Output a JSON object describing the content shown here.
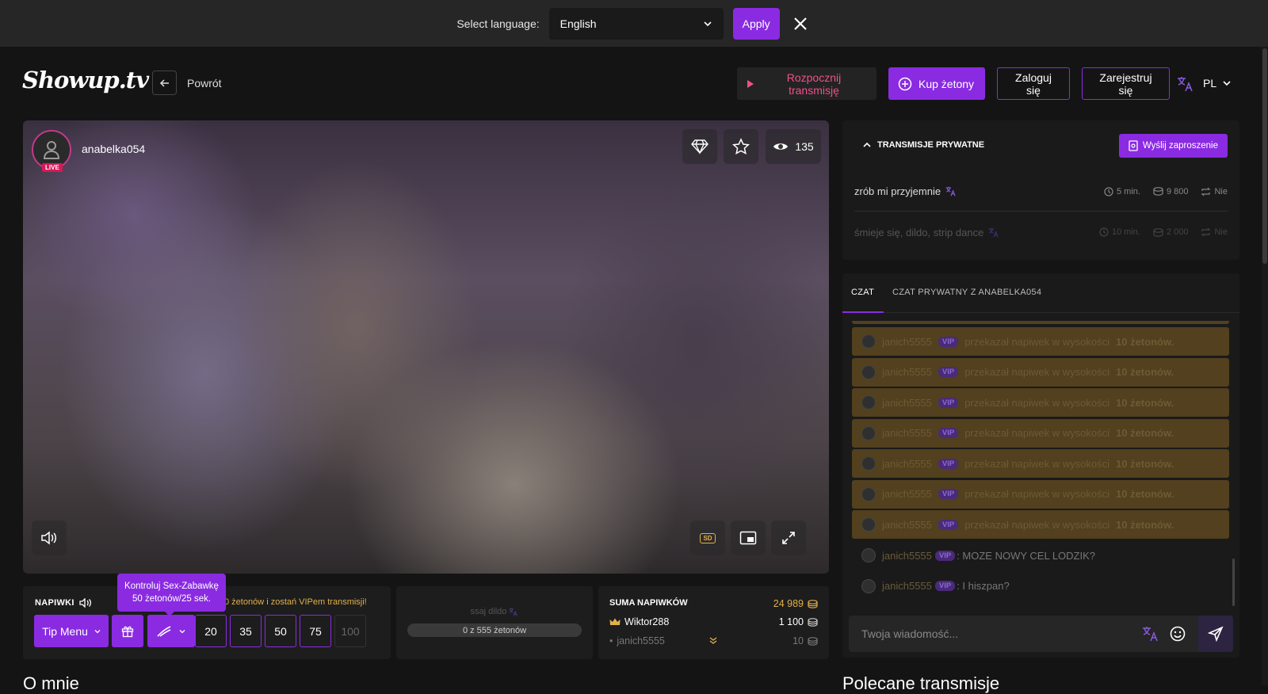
{
  "language_bar": {
    "label": "Select language:",
    "selected": "English",
    "apply_label": "Apply"
  },
  "header": {
    "logo": "Showup.tv",
    "back_label": "Powrót",
    "start_stream": "Rozpocznij transmisję",
    "buy_tokens": "Kup żetony",
    "login": "Zaloguj się",
    "register": "Zarejestruj się",
    "ui_lang": "PL"
  },
  "stream": {
    "username": "anabelka054",
    "live_badge": "LIVE",
    "viewers": "135",
    "quality": "SD"
  },
  "tips": {
    "title": "NAPIWKI",
    "vip_promo": "0 żetonów i zostań VIPem transmisji!",
    "tooltip_line1": "Kontroluj Sex-Zabawkę",
    "tooltip_line2": "50 żetonów/25 sek.",
    "tip_menu": "Tip Menu",
    "amounts": [
      "20",
      "35",
      "50",
      "75",
      "100"
    ]
  },
  "goal": {
    "label": "ssaj dildo",
    "progress_text": "0 z 555 żetonów",
    "progress_fraction": 0
  },
  "tip_sum": {
    "title": "SUMA NAPIWKÓW",
    "total": "24 989",
    "rows": [
      {
        "name": "Wiktor288",
        "amount": "1 100"
      },
      {
        "name": "janich5555",
        "amount": "10"
      }
    ]
  },
  "sections": {
    "about": "O mnie",
    "recommended": "Polecane transmisje"
  },
  "private_shows": {
    "title": "TRANSMISJE PRYWATNE",
    "invite_btn": "Wyślij zaproszenie",
    "items": [
      {
        "desc": "zrób mi przyjemnie",
        "duration": "5 min.",
        "price": "9 800",
        "repeat": "Nie"
      },
      {
        "desc": "śmieje się, dildo, strip dance",
        "duration": "10 min.",
        "price": "2 000",
        "repeat": "Nie"
      }
    ]
  },
  "chat": {
    "tab_public": "CZAT",
    "tab_private": "CZAT PRYWATNY Z ANABELKA054",
    "vip_label": "VIP",
    "tip_user": "janich5555",
    "tip_text": "przekazał napiwek w wysokości",
    "tip_amount": "10 żetonów.",
    "plain_msgs": [
      {
        "user": "janich5555",
        "text": ": MOZE NOWY CEL LODZIK?"
      },
      {
        "user": "janich5555",
        "text": ": I hiszpan?"
      }
    ],
    "input_placeholder": "Twoja wiadomość..."
  },
  "colors": {
    "accent": "#8a2be2",
    "gold": "#e2b04a",
    "start_pink": "#f0508a"
  }
}
